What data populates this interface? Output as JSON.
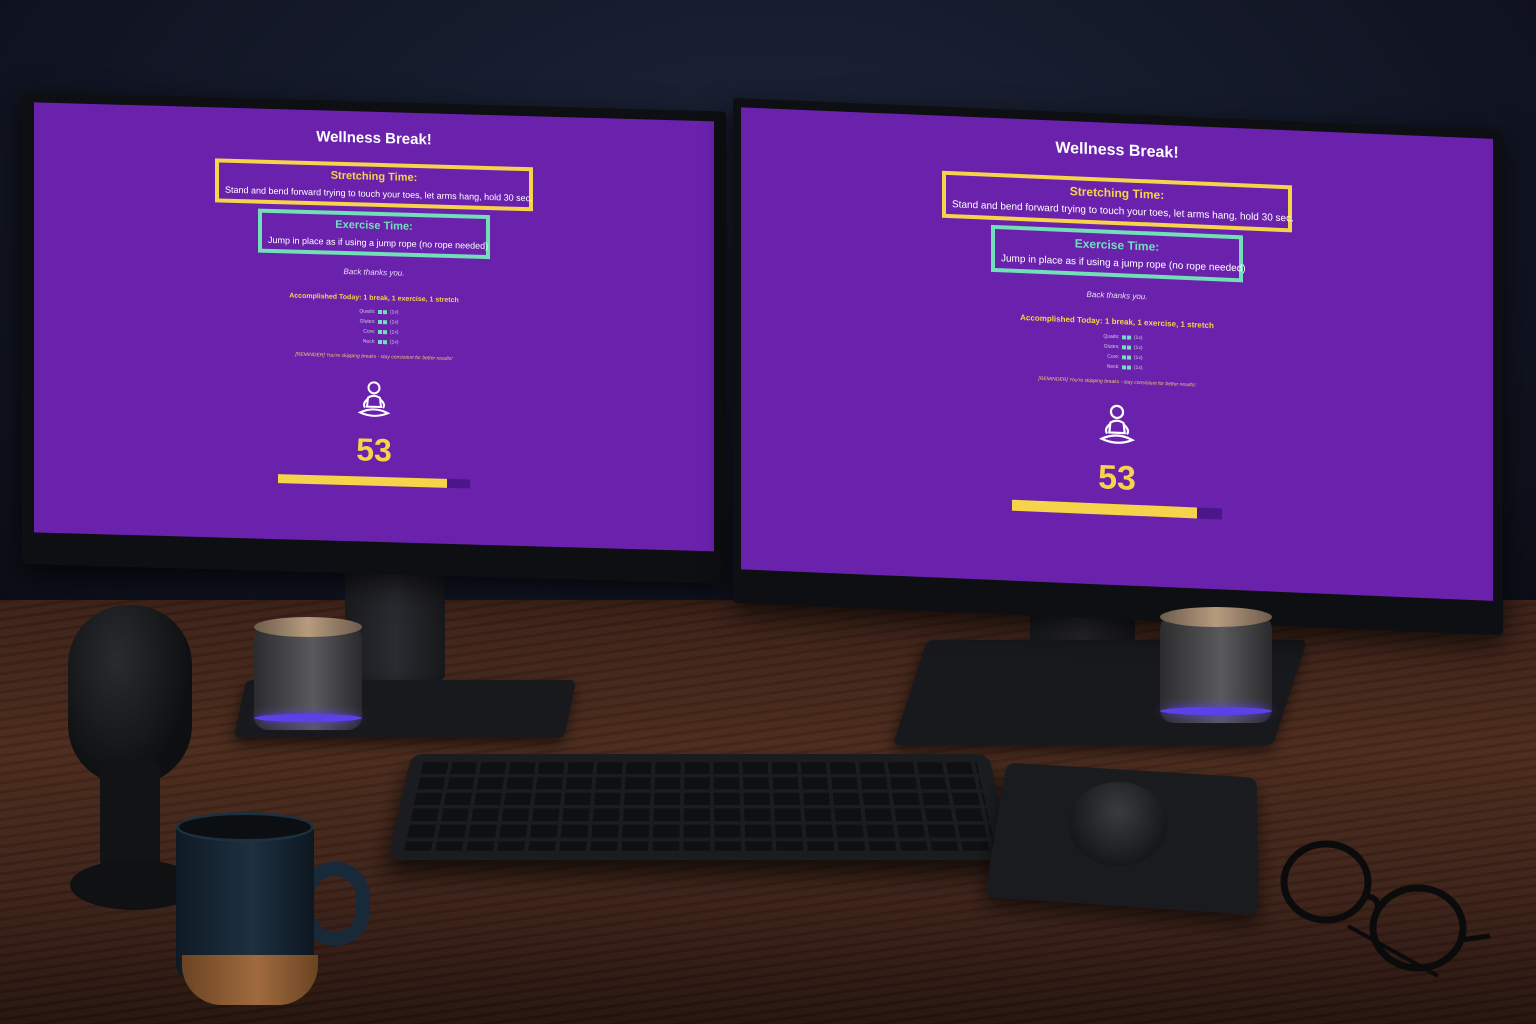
{
  "app": {
    "title": "Wellness Break!",
    "stretching": {
      "heading": "Stretching Time:",
      "text": "Stand and bend forward trying to touch your toes, let arms hang, hold 30 sec."
    },
    "exercise": {
      "heading": "Exercise Time:",
      "text": "Jump in place as if using a jump rope (no rope needed)"
    },
    "thanks": "Back thanks you.",
    "accomplished": "Accomplished Today: 1 break, 1 exercise, 1 stretch",
    "tally": [
      {
        "label": "Quads:",
        "value": "(1x)"
      },
      {
        "label": "Glutes:",
        "value": "(1x)"
      },
      {
        "label": "Core:",
        "value": "(1x)"
      },
      {
        "label": "Neck:",
        "value": "(1x)"
      }
    ],
    "reminder": "[REMINDER] You're skipping breaks - stay consistent for better results!",
    "figure_icon": "meditation-figure-icon",
    "countdown": "53",
    "progress_fraction": 0.88
  },
  "colors": {
    "screen_bg": "#6a22ad",
    "accent_yellow": "#f6d34a",
    "accent_mint": "#71e0b8",
    "progress_track": "#4a168a"
  }
}
